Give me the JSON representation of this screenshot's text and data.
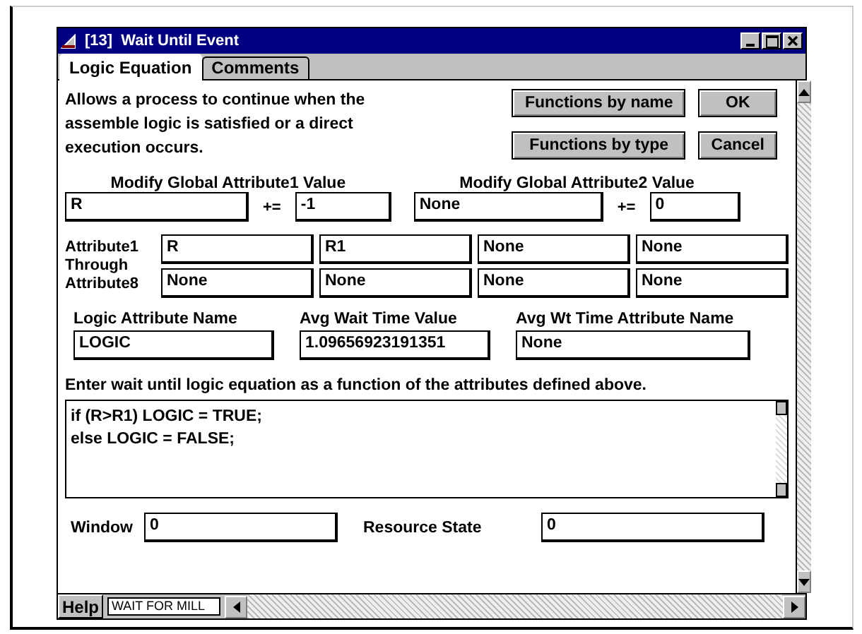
{
  "window": {
    "title": "[13]  Wait Until Event"
  },
  "tabs": [
    {
      "label": "Logic Equation",
      "selected": true
    },
    {
      "label": "Comments",
      "selected": false
    }
  ],
  "description": "Allows a process to continue when the assemble logic is satisfied or a direct execution occurs.",
  "buttons": [
    "Functions by name",
    "OK",
    "Functions by type",
    "Cancel"
  ],
  "global_attributes": [
    {
      "label": "Modify Global Attribute1 Value",
      "attribute": "R",
      "operator": "+=",
      "value": "-1"
    },
    {
      "label": "Modify Global Attribute2 Value",
      "attribute": "None",
      "operator": "+=",
      "value": "0"
    }
  ],
  "attributes": {
    "label": "Attribute1 Through Attribute8",
    "values": [
      "R",
      "R1",
      "None",
      "None",
      "None",
      "None",
      "None",
      "None"
    ]
  },
  "fields": [
    {
      "label": "Logic Attribute Name",
      "value": "LOGIC"
    },
    {
      "label": "Avg Wait Time Value",
      "value": "1.09656923191351"
    },
    {
      "label": "Avg Wt Time Attribute Name",
      "value": "None"
    }
  ],
  "instruction": "Enter wait until logic equation as a function of the attributes defined above.",
  "equation": [
    "if (R>R1)  LOGIC = TRUE;",
    "else LOGIC = FALSE;"
  ],
  "bottom_fields": [
    {
      "label": "Window",
      "value": "0"
    },
    {
      "label": "Resource State",
      "value": "0"
    }
  ],
  "help_button": "Help",
  "status": "WAIT FOR MILL"
}
